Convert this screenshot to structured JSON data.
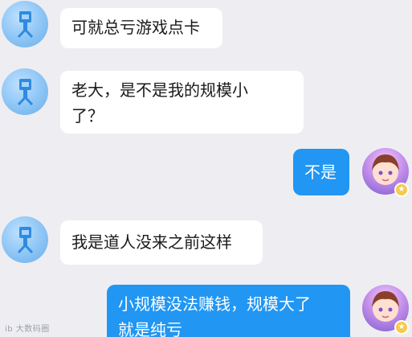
{
  "messages": [
    {
      "side": "left",
      "text": "可就总亏游戏点卡"
    },
    {
      "side": "left",
      "text": "老大，是不是我的规模小\n了？"
    },
    {
      "side": "right",
      "text": "不是"
    },
    {
      "side": "left",
      "text": "我是道人没来之前这样"
    },
    {
      "side": "right",
      "text": "小规模没法赚钱，规模大了\n就是纯亏"
    }
  ],
  "watermark": "ib 大数码圈",
  "colors": {
    "background": "#eeeef2",
    "incoming_bubble": "#ffffff",
    "outgoing_bubble": "#2196f3"
  },
  "icons": {
    "left_avatar": "robot-avatar-icon",
    "right_avatar": "anime-girl-avatar-icon",
    "badge": "crown-badge-icon"
  }
}
